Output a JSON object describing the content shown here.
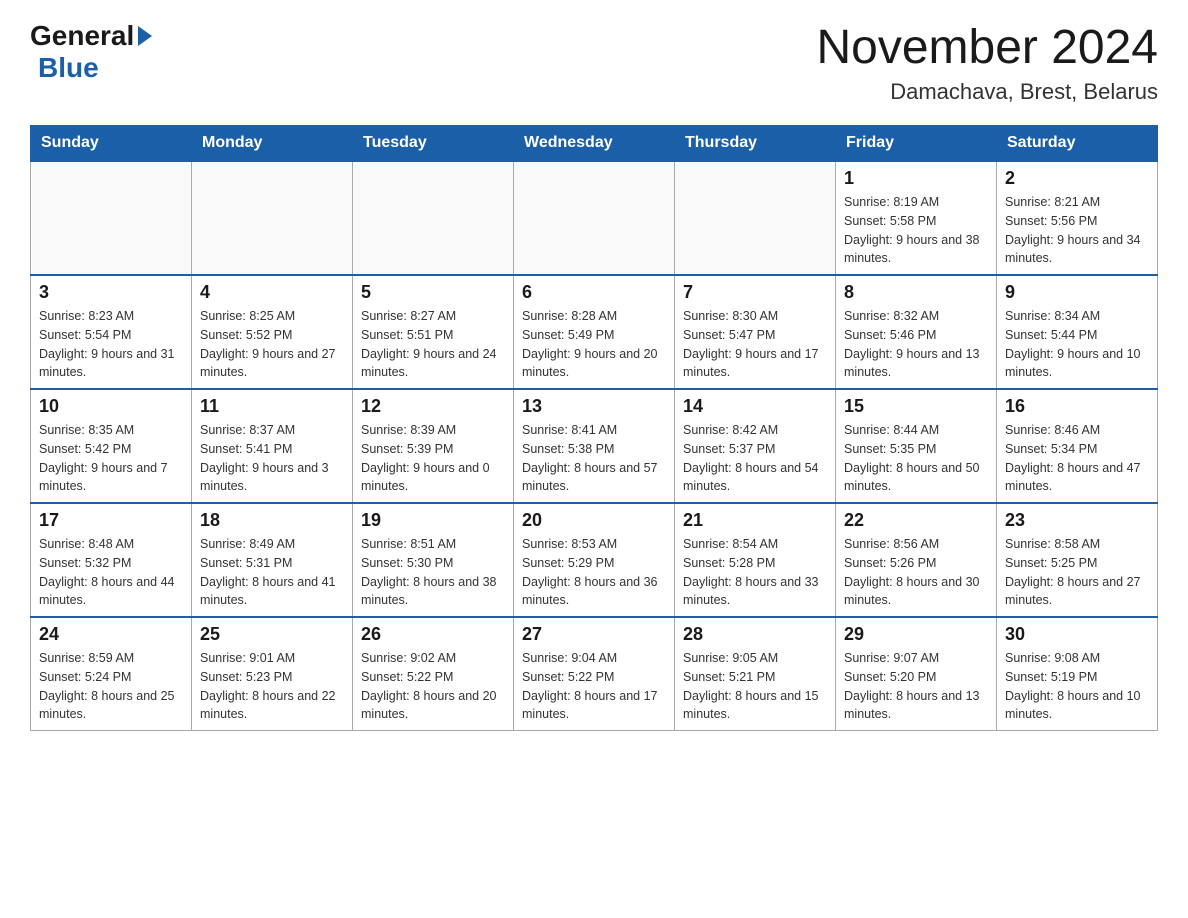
{
  "header": {
    "logo_general": "General",
    "logo_blue": "Blue",
    "month_title": "November 2024",
    "location": "Damachava, Brest, Belarus"
  },
  "days_of_week": [
    "Sunday",
    "Monday",
    "Tuesday",
    "Wednesday",
    "Thursday",
    "Friday",
    "Saturday"
  ],
  "weeks": [
    [
      {
        "day": "",
        "detail": ""
      },
      {
        "day": "",
        "detail": ""
      },
      {
        "day": "",
        "detail": ""
      },
      {
        "day": "",
        "detail": ""
      },
      {
        "day": "",
        "detail": ""
      },
      {
        "day": "1",
        "detail": "Sunrise: 8:19 AM\nSunset: 5:58 PM\nDaylight: 9 hours and 38 minutes."
      },
      {
        "day": "2",
        "detail": "Sunrise: 8:21 AM\nSunset: 5:56 PM\nDaylight: 9 hours and 34 minutes."
      }
    ],
    [
      {
        "day": "3",
        "detail": "Sunrise: 8:23 AM\nSunset: 5:54 PM\nDaylight: 9 hours and 31 minutes."
      },
      {
        "day": "4",
        "detail": "Sunrise: 8:25 AM\nSunset: 5:52 PM\nDaylight: 9 hours and 27 minutes."
      },
      {
        "day": "5",
        "detail": "Sunrise: 8:27 AM\nSunset: 5:51 PM\nDaylight: 9 hours and 24 minutes."
      },
      {
        "day": "6",
        "detail": "Sunrise: 8:28 AM\nSunset: 5:49 PM\nDaylight: 9 hours and 20 minutes."
      },
      {
        "day": "7",
        "detail": "Sunrise: 8:30 AM\nSunset: 5:47 PM\nDaylight: 9 hours and 17 minutes."
      },
      {
        "day": "8",
        "detail": "Sunrise: 8:32 AM\nSunset: 5:46 PM\nDaylight: 9 hours and 13 minutes."
      },
      {
        "day": "9",
        "detail": "Sunrise: 8:34 AM\nSunset: 5:44 PM\nDaylight: 9 hours and 10 minutes."
      }
    ],
    [
      {
        "day": "10",
        "detail": "Sunrise: 8:35 AM\nSunset: 5:42 PM\nDaylight: 9 hours and 7 minutes."
      },
      {
        "day": "11",
        "detail": "Sunrise: 8:37 AM\nSunset: 5:41 PM\nDaylight: 9 hours and 3 minutes."
      },
      {
        "day": "12",
        "detail": "Sunrise: 8:39 AM\nSunset: 5:39 PM\nDaylight: 9 hours and 0 minutes."
      },
      {
        "day": "13",
        "detail": "Sunrise: 8:41 AM\nSunset: 5:38 PM\nDaylight: 8 hours and 57 minutes."
      },
      {
        "day": "14",
        "detail": "Sunrise: 8:42 AM\nSunset: 5:37 PM\nDaylight: 8 hours and 54 minutes."
      },
      {
        "day": "15",
        "detail": "Sunrise: 8:44 AM\nSunset: 5:35 PM\nDaylight: 8 hours and 50 minutes."
      },
      {
        "day": "16",
        "detail": "Sunrise: 8:46 AM\nSunset: 5:34 PM\nDaylight: 8 hours and 47 minutes."
      }
    ],
    [
      {
        "day": "17",
        "detail": "Sunrise: 8:48 AM\nSunset: 5:32 PM\nDaylight: 8 hours and 44 minutes."
      },
      {
        "day": "18",
        "detail": "Sunrise: 8:49 AM\nSunset: 5:31 PM\nDaylight: 8 hours and 41 minutes."
      },
      {
        "day": "19",
        "detail": "Sunrise: 8:51 AM\nSunset: 5:30 PM\nDaylight: 8 hours and 38 minutes."
      },
      {
        "day": "20",
        "detail": "Sunrise: 8:53 AM\nSunset: 5:29 PM\nDaylight: 8 hours and 36 minutes."
      },
      {
        "day": "21",
        "detail": "Sunrise: 8:54 AM\nSunset: 5:28 PM\nDaylight: 8 hours and 33 minutes."
      },
      {
        "day": "22",
        "detail": "Sunrise: 8:56 AM\nSunset: 5:26 PM\nDaylight: 8 hours and 30 minutes."
      },
      {
        "day": "23",
        "detail": "Sunrise: 8:58 AM\nSunset: 5:25 PM\nDaylight: 8 hours and 27 minutes."
      }
    ],
    [
      {
        "day": "24",
        "detail": "Sunrise: 8:59 AM\nSunset: 5:24 PM\nDaylight: 8 hours and 25 minutes."
      },
      {
        "day": "25",
        "detail": "Sunrise: 9:01 AM\nSunset: 5:23 PM\nDaylight: 8 hours and 22 minutes."
      },
      {
        "day": "26",
        "detail": "Sunrise: 9:02 AM\nSunset: 5:22 PM\nDaylight: 8 hours and 20 minutes."
      },
      {
        "day": "27",
        "detail": "Sunrise: 9:04 AM\nSunset: 5:22 PM\nDaylight: 8 hours and 17 minutes."
      },
      {
        "day": "28",
        "detail": "Sunrise: 9:05 AM\nSunset: 5:21 PM\nDaylight: 8 hours and 15 minutes."
      },
      {
        "day": "29",
        "detail": "Sunrise: 9:07 AM\nSunset: 5:20 PM\nDaylight: 8 hours and 13 minutes."
      },
      {
        "day": "30",
        "detail": "Sunrise: 9:08 AM\nSunset: 5:19 PM\nDaylight: 8 hours and 10 minutes."
      }
    ]
  ]
}
